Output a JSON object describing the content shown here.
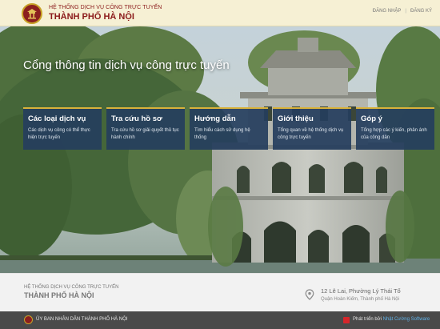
{
  "header": {
    "brand_line1": "HỆ THỐNG DỊCH VỤ CÔNG TRỰC TUYẾN",
    "brand_line2": "THÀNH PHỐ HÀ NỘI",
    "login_label": "ĐĂNG NHẬP",
    "register_label": "ĐĂNG KÝ"
  },
  "hero": {
    "title": "Cổng thông tin dịch vụ công trực tuyến",
    "cards": [
      {
        "title": "Các loại dịch vụ",
        "desc": "Các dịch vụ công có thể thực hiện trực tuyến"
      },
      {
        "title": "Tra cứu hồ sơ",
        "desc": "Tra cứu hồ sơ giải quyết thủ tục hành chính"
      },
      {
        "title": "Hướng dẫn",
        "desc": "Tìm hiểu cách sử dụng hệ thống"
      },
      {
        "title": "Giới thiệu",
        "desc": "Tổng quan về hệ thống dịch vụ công trực tuyến"
      },
      {
        "title": "Góp ý",
        "desc": "Tổng hợp các ý kiến, phản ánh của công dân"
      }
    ]
  },
  "footer": {
    "brand_line1": "HỆ THỐNG DỊCH VỤ CÔNG TRỰC TUYẾN",
    "brand_line2": "THÀNH PHỐ HÀ NỘI",
    "address_line1": "12 Lê Lai, Phường Lý Thái Tổ",
    "address_line2": "Quận Hoàn Kiếm, Thành phố Hà Nội",
    "location_icon": "map-pin-icon"
  },
  "bottom_bar": {
    "left_text": "ỦY BAN NHÂN DÂN THÀNH PHỐ HÀ NỘI",
    "developed_by": "Phát triển bởi",
    "developer": "Nhật Cường Software"
  },
  "colors": {
    "header_bg": "#f6f0d4",
    "brand_red": "#8b1a1a",
    "card_bg": "#253e5d",
    "card_accent": "#d9b23a",
    "footer_bg": "#f2f2f2",
    "bottom_bar_bg": "#4a4a4a",
    "developer_link": "#5fb0e6"
  }
}
